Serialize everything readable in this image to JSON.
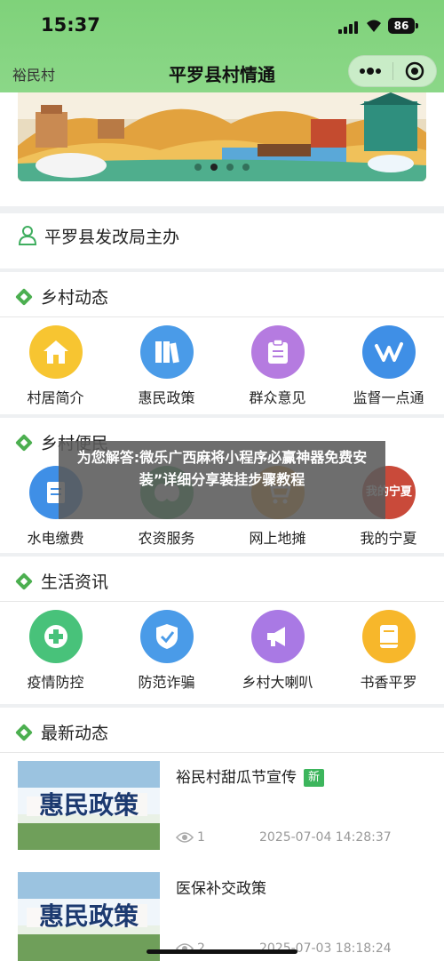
{
  "status_bar": {
    "time": "15:37",
    "battery": "86"
  },
  "nav": {
    "back_label": "裕民村",
    "title": "平罗县村情通"
  },
  "sponsor": {
    "text": "平罗县发改局主办"
  },
  "sections": [
    {
      "title": "乡村动态",
      "items": [
        {
          "label": "村居简介",
          "icon": "house-icon",
          "color": "#f7c531"
        },
        {
          "label": "惠民政策",
          "icon": "books-icon",
          "color": "#4a9be8"
        },
        {
          "label": "群众意见",
          "icon": "clipboard-icon",
          "color": "#b57be0"
        },
        {
          "label": "监督一点通",
          "icon": "supervision-logo-icon",
          "color": "#3f8fe6"
        }
      ]
    },
    {
      "title": "乡村便民",
      "items": [
        {
          "label": "水电缴费",
          "icon": "bill-icon",
          "color": "#3f8fe6"
        },
        {
          "label": "农资服务",
          "icon": "seed-icon",
          "color": "#3fae5f"
        },
        {
          "label": "网上地摊",
          "icon": "cart-icon",
          "color": "#f2a52a"
        },
        {
          "label": "我的宁夏",
          "icon": "ningxia-logo-icon",
          "color": "#c94a3a",
          "logo_text": "我的宁夏"
        }
      ]
    },
    {
      "title": "生活资讯",
      "items": [
        {
          "label": "疫情防控",
          "icon": "medical-cross-icon",
          "color": "#48c27a"
        },
        {
          "label": "防范诈骗",
          "icon": "shield-check-icon",
          "color": "#4a9be8"
        },
        {
          "label": "乡村大喇叭",
          "icon": "megaphone-icon",
          "color": "#a979e4"
        },
        {
          "label": "书香平罗",
          "icon": "book-icon",
          "color": "#f7b72b"
        }
      ]
    }
  ],
  "news": {
    "title": "最新动态",
    "items": [
      {
        "thumb_text": "惠民政策",
        "title": "裕民村甜瓜节宣传",
        "badge": "新",
        "views": "1",
        "date": "2025-07-04 14:28:37"
      },
      {
        "thumb_text": "惠民政策",
        "title": "医保补交政策",
        "badge": "",
        "views": "2",
        "date": "2025-07-03 18:18:24"
      }
    ]
  },
  "overlay_text": "为您解答:微乐广西麻将小程序必赢神器免费安装”详细分享装挂步骤教程"
}
